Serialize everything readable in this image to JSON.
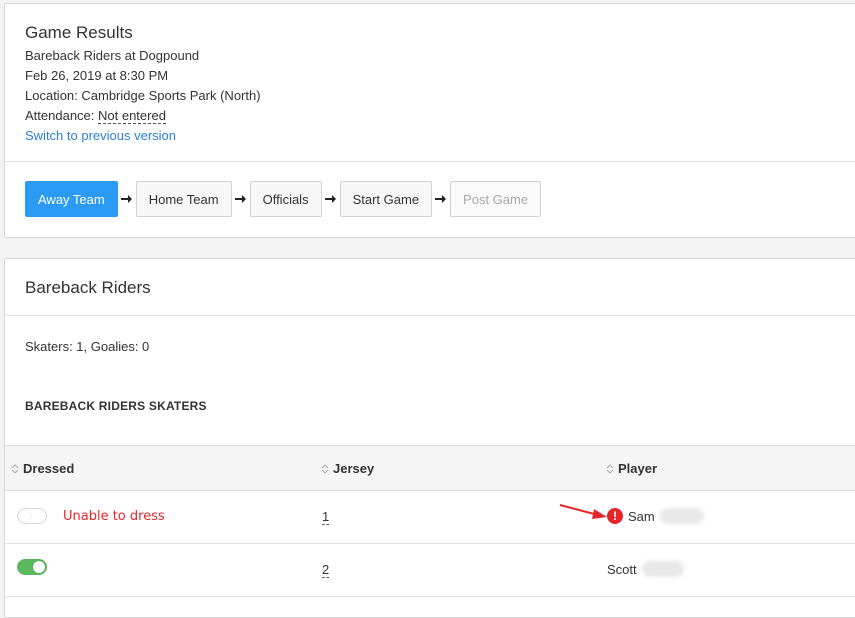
{
  "game": {
    "title": "Game Results",
    "matchup": "Bareback Riders at Dogpound",
    "datetime": "Feb 26, 2019 at 8:30 PM",
    "location": "Location: Cambridge Sports Park (North)",
    "attendance_label": "Attendance: ",
    "attendance_value": "Not entered",
    "switch_link": "Switch to previous version"
  },
  "steps": [
    {
      "label": "Away Team",
      "state": "active"
    },
    {
      "label": "Home Team",
      "state": "normal"
    },
    {
      "label": "Officials",
      "state": "normal"
    },
    {
      "label": "Start Game",
      "state": "normal"
    },
    {
      "label": "Post Game",
      "state": "disabled"
    }
  ],
  "team": {
    "title": "Bareback Riders",
    "counts": "Skaters: 1, Goalies: 0",
    "section_title": "BAREBACK RIDERS SKATERS"
  },
  "table": {
    "headers": {
      "dressed": "Dressed",
      "jersey": "Jersey",
      "player": "Player"
    },
    "rows": [
      {
        "dressed": false,
        "status": "Unable to dress",
        "jersey": "1",
        "player": "Sam",
        "warning": true
      },
      {
        "dressed": true,
        "status": "",
        "jersey": "2",
        "player": "Scott",
        "warning": false
      }
    ]
  },
  "colors": {
    "primary": "#2a9af3",
    "toggle_on": "#5cb85c",
    "error": "#e3262a",
    "link": "#2d7fd6"
  },
  "icons": {
    "step_separator": "arrow-right-icon",
    "sort": "sort-icon",
    "warning": "exclamation-circle-icon"
  }
}
